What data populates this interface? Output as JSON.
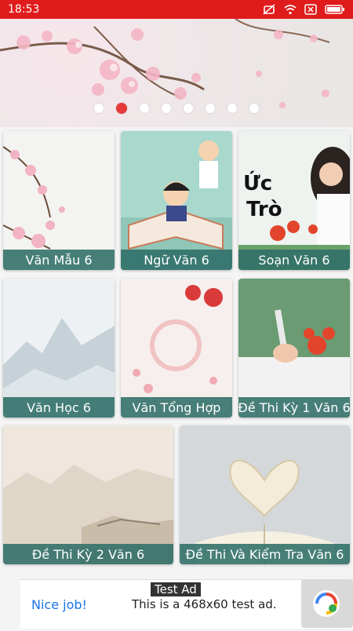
{
  "status": {
    "time": "18:53"
  },
  "banner": {
    "slides": 8,
    "active_index": 1
  },
  "tiles": [
    {
      "label": "Văn Mẫu 6"
    },
    {
      "label": "Ngữ Văn 6"
    },
    {
      "label": "Soạn Văn 6",
      "art_text_1": "Ức",
      "art_text_2": "Trò"
    },
    {
      "label": "Văn Học 6"
    },
    {
      "label": "Văn Tổng Hợp"
    },
    {
      "label": "Đề Thi Kỳ 1 Văn 6"
    },
    {
      "label": "Đề Thi Kỳ 2 Văn 6"
    },
    {
      "label": "Đề Thi Và Kiểm Tra Văn 6"
    }
  ],
  "ad": {
    "badge": "Test Ad",
    "nice": "Nice job!",
    "text": "This is a 468x60 test ad."
  }
}
